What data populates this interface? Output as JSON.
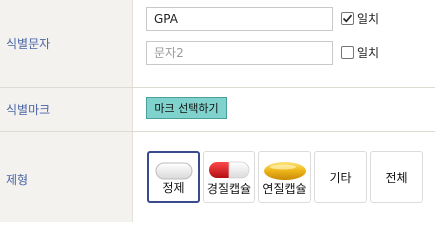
{
  "identifier": {
    "label": "식별문자",
    "input1": {
      "value": "GPA",
      "placeholder": ""
    },
    "match1": {
      "label": "일치",
      "checked": true
    },
    "input2": {
      "value": "",
      "placeholder": "문자2"
    },
    "match2": {
      "label": "일치",
      "checked": false
    }
  },
  "mark": {
    "label": "식별마크",
    "button_label": "마크 선택하기"
  },
  "form": {
    "label": "제형",
    "options": [
      {
        "label": "정제",
        "icon": "tablet-icon",
        "selected": true
      },
      {
        "label": "경질캡슐",
        "icon": "hard-capsule-icon",
        "selected": false
      },
      {
        "label": "연질캡슐",
        "icon": "soft-capsule-icon",
        "selected": false
      },
      {
        "label": "기타",
        "icon": "",
        "selected": false
      },
      {
        "label": "전체",
        "icon": "",
        "selected": false
      }
    ]
  },
  "colors": {
    "label_text": "#4a64a6",
    "mark_button_bg": "#7fd3cc",
    "selected_border": "#3a4a8f",
    "hard_capsule_red": "#d0161b",
    "soft_capsule_gold": "#e9b316"
  }
}
